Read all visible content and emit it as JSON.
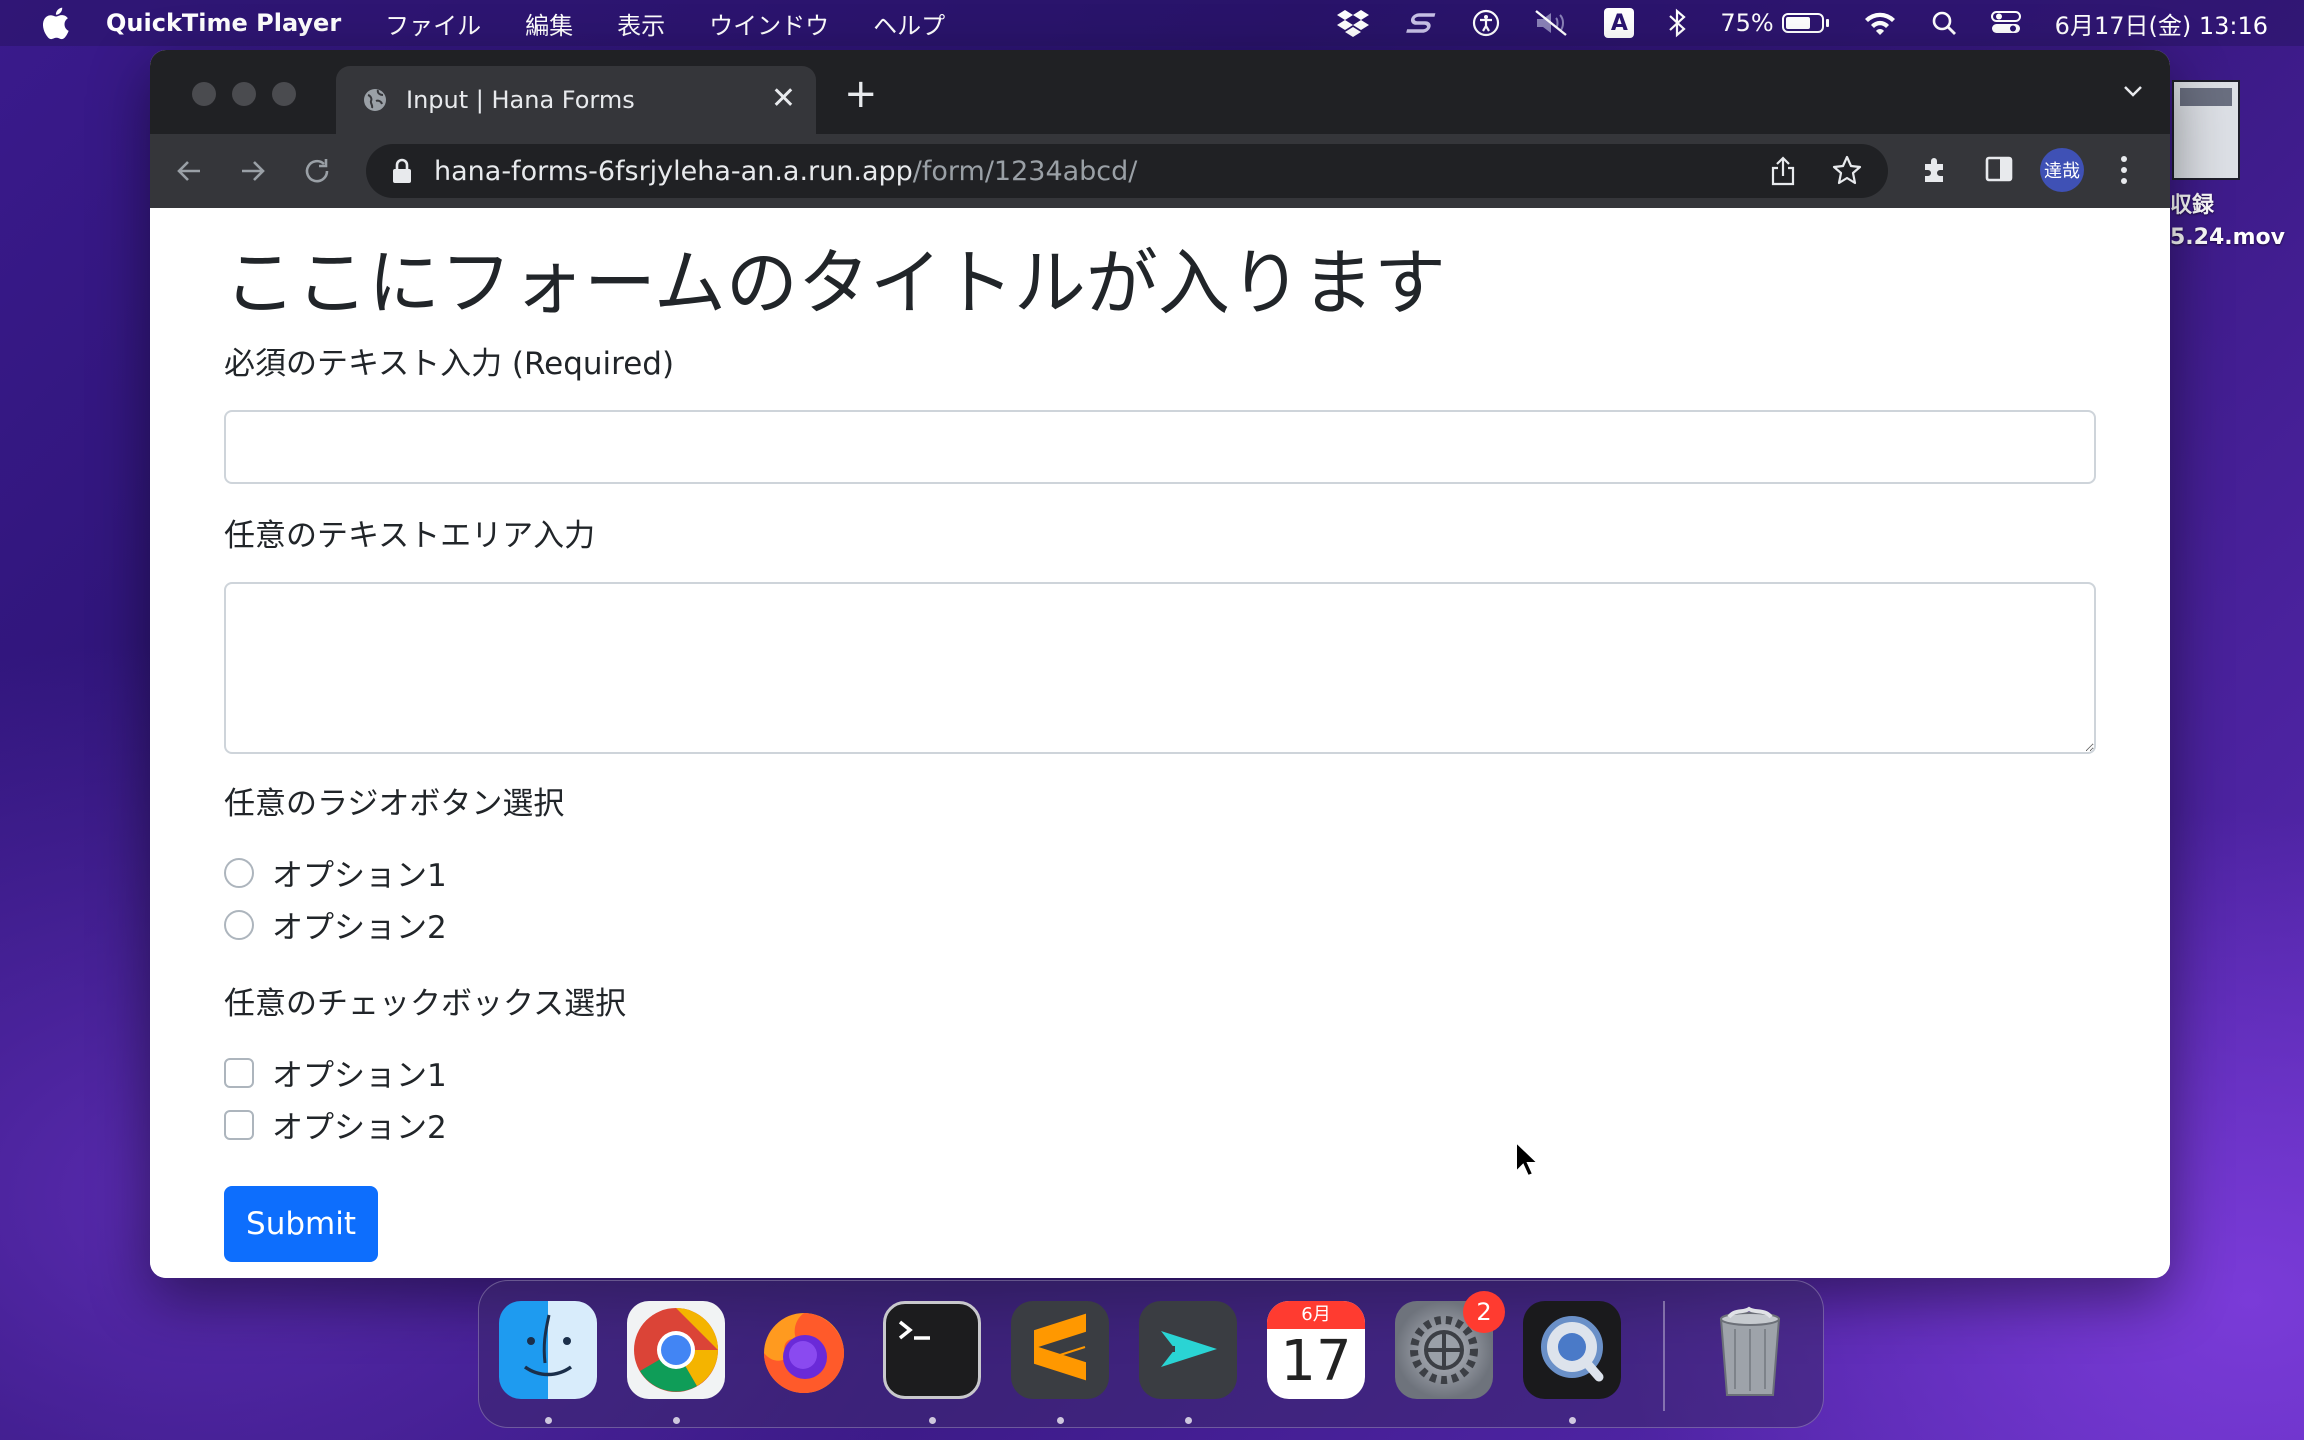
{
  "menubar": {
    "app_name": "QuickTime Player",
    "menus": [
      "ファイル",
      "編集",
      "表示",
      "ウインドウ",
      "ヘルプ"
    ],
    "ime_label": "A",
    "battery_percent": "75%",
    "battery_level": 0.75,
    "datetime": "6月17日(金) 13:16",
    "status_icons": [
      "dropbox-icon",
      "s-icon",
      "accessibility-icon",
      "mute-icon",
      "input-source-icon",
      "bluetooth-icon",
      "battery-icon",
      "wifi-icon",
      "spotlight-icon",
      "control-center-icon"
    ]
  },
  "desktop": {
    "file_label_line1": "収録",
    "file_label_line2": "5.24.mov"
  },
  "browser": {
    "tab_title": "Input | Hana Forms",
    "url_host": "hana-forms-6fsrjyleha-an.a.run.app",
    "url_path": "/form/1234abcd/",
    "profile_label": "達哉"
  },
  "form": {
    "title": "ここにフォームのタイトルが入ります",
    "text_label": "必須のテキスト入力 (Required)",
    "text_value": "",
    "textarea_label": "任意のテキストエリア入力",
    "textarea_value": "",
    "radio_label": "任意のラジオボタン選択",
    "radio_options": [
      "オプション1",
      "オプション2"
    ],
    "checkbox_label": "任意のチェックボックス選択",
    "checkbox_options": [
      "オプション1",
      "オプション2"
    ],
    "submit_label": "Submit"
  },
  "dock": {
    "apps": [
      "finder",
      "chrome",
      "firefox",
      "terminal",
      "sublime-text",
      "app-launcher",
      "calendar",
      "system-preferences",
      "quicktime",
      "trash"
    ],
    "calendar_month": "6月",
    "calendar_day": "17",
    "system_preferences_badge": "2"
  },
  "colors": {
    "submit_button": "#0d6efd",
    "browser_frame": "#35363a",
    "tab_strip": "#202124"
  }
}
